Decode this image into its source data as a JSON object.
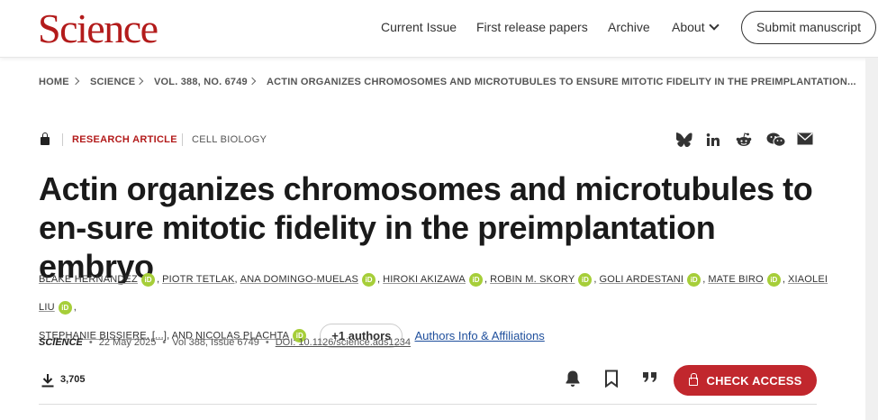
{
  "header": {
    "logo": "Science",
    "nav": {
      "current_issue": "Current Issue",
      "first_release": "First release papers",
      "archive": "Archive",
      "about": "About"
    },
    "submit_label": "Submit manuscript"
  },
  "breadcrumb": {
    "home": "HOME",
    "science": "SCIENCE",
    "volume": "VOL. 388, NO. 6749",
    "current": "ACTIN ORGANIZES CHROMOSOMES AND MICROTUBULES TO ENSURE MITOTIC FIDELITY IN THE PREIMPLANTATION..."
  },
  "article": {
    "type": "RESEARCH ARTICLE",
    "category": "CELL BIOLOGY",
    "title": "Actin organizes chromosomes and microtubules to en-sure mitotic fidelity in the preimplantation embryo",
    "authors": {
      "a1": "BLAKE HERNANDEZ",
      "a2": "PIOTR TETLAK",
      "a3": "ANA DOMINGO-MUELAS",
      "a4": "HIROKI AKIZAWA",
      "a5": "ROBIN M. SKORY",
      "a6": "GOLI ARDESTANI",
      "a7": "MATE BIRO",
      "a8": "XIAOLEI LIU",
      "a9": "STEPHANIE BISSIERE",
      "ellipsis": "[...]",
      "and": ", AND",
      "a10": "NICOLAS PLACHTA"
    },
    "orcid_label": "iD",
    "plus_authors": "+1 authors",
    "affiliations_link": "Authors Info & Affiliations",
    "journal": "SCIENCE",
    "date": "22 May 2025",
    "volume_issue": "Vol 388, Issue 6749",
    "doi": "DOI: 10.1126/science.ads1234",
    "downloads": "3,705"
  },
  "actions": {
    "check_access": "CHECK ACCESS"
  },
  "colors": {
    "brand_red": "#b31b1b",
    "button_red": "#c1272d",
    "orcid_green": "#a6ce39",
    "link_blue": "#1f4f9c"
  },
  "icons": [
    "bluesky-icon",
    "linkedin-icon",
    "reddit-icon",
    "wechat-icon",
    "email-icon",
    "lock-icon",
    "download-icon",
    "bell-icon",
    "bookmark-icon",
    "quote-icon"
  ]
}
